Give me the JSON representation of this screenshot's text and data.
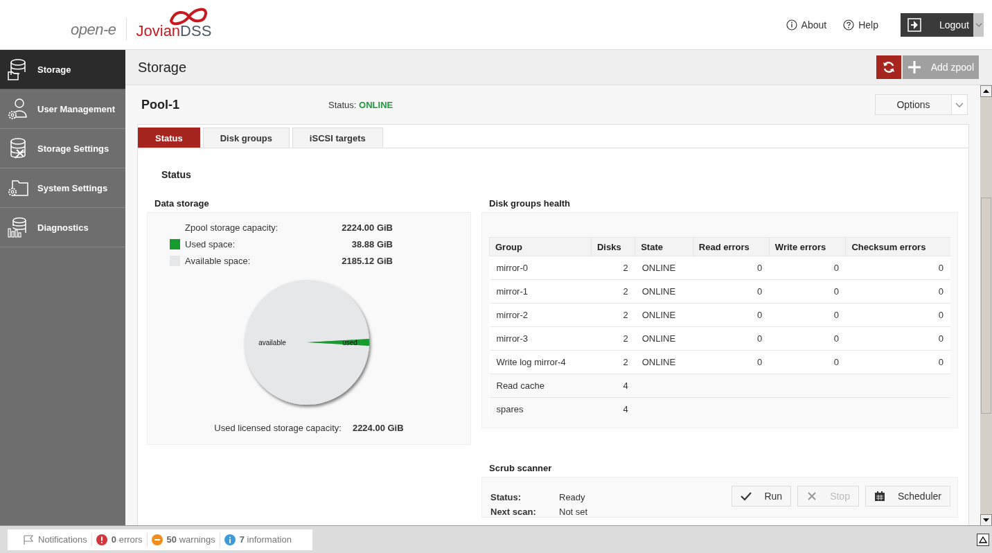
{
  "header": {
    "logo": {
      "brand": "open-e",
      "product_main": "Jovian",
      "product_suffix": "DSS"
    },
    "links": [
      {
        "label": "About",
        "kind": "info"
      },
      {
        "label": "Help",
        "kind": "help"
      }
    ],
    "logout": "Logout"
  },
  "sidebar": {
    "items": [
      {
        "label": "Storage",
        "kind": "storage",
        "selected": true
      },
      {
        "label": "User Management",
        "kind": "user",
        "selected": false
      },
      {
        "label": "Storage Settings",
        "kind": "storage-settings",
        "selected": false
      },
      {
        "label": "System Settings",
        "kind": "system",
        "selected": false
      },
      {
        "label": "Diagnostics",
        "kind": "diagnostics",
        "selected": false
      }
    ]
  },
  "page": {
    "title": "Storage",
    "add_button": "Add zpool"
  },
  "pool": {
    "name": "Pool-1",
    "status_label": "Status:",
    "status": "ONLINE",
    "options": "Options",
    "tabs": [
      {
        "label": "Status",
        "selected": true
      },
      {
        "label": "Disk groups",
        "selected": false
      },
      {
        "label": "iSCSI targets",
        "selected": false
      }
    ],
    "section_title": "Status",
    "data_storage": {
      "title": "Data storage",
      "rows": [
        {
          "label": "Zpool storage capacity:",
          "value": "2224.00 GiB"
        },
        {
          "label": "Used space:",
          "value": "38.88 GiB",
          "color": "#169b2f"
        },
        {
          "label": "Available space:",
          "value": "2185.12 GiB",
          "color": "#e6e7e9"
        }
      ],
      "chart_data": {
        "type": "pie",
        "categories": [
          "available",
          "used"
        ],
        "values": [
          98.25,
          1.75
        ],
        "colors": [
          "#e6e7e9",
          "#169b2f"
        ]
      },
      "licensed_label": "Used licensed storage capacity:",
      "licensed_value": "2224.00 GiB"
    },
    "disk_groups": {
      "title": "Disk groups health",
      "columns": [
        "Group",
        "Disks",
        "State",
        "Read errors",
        "Write errors",
        "Checksum errors"
      ],
      "rows": [
        {
          "group": "mirror-0",
          "disks": "2",
          "state": "ONLINE",
          "read": "0",
          "write": "0",
          "checksum": "0"
        },
        {
          "group": "mirror-1",
          "disks": "2",
          "state": "ONLINE",
          "read": "0",
          "write": "0",
          "checksum": "0"
        },
        {
          "group": "mirror-2",
          "disks": "2",
          "state": "ONLINE",
          "read": "0",
          "write": "0",
          "checksum": "0"
        },
        {
          "group": "mirror-3",
          "disks": "2",
          "state": "ONLINE",
          "read": "0",
          "write": "0",
          "checksum": "0"
        },
        {
          "group": "Write log mirror-4",
          "disks": "2",
          "state": "ONLINE",
          "read": "0",
          "write": "0",
          "checksum": "0"
        },
        {
          "group": "Read cache",
          "disks": "4"
        },
        {
          "group": "spares",
          "disks": "4"
        }
      ]
    },
    "scrub": {
      "title": "Scrub scanner",
      "fields": [
        {
          "label": "Status:",
          "value": "Ready"
        },
        {
          "label": "Next scan:",
          "value": "Not set"
        }
      ],
      "buttons": [
        {
          "label": "Run",
          "kind": "run",
          "disabled": false
        },
        {
          "label": "Stop",
          "kind": "stop",
          "disabled": true
        },
        {
          "label": "Scheduler",
          "kind": "scheduler",
          "disabled": false
        }
      ]
    }
  },
  "notifications": {
    "label": "Notifications",
    "items": [
      {
        "kind": "error",
        "count": "0",
        "label": "errors"
      },
      {
        "kind": "warning",
        "count": "50",
        "label": "warnings"
      },
      {
        "kind": "info",
        "count": "7",
        "label": "information"
      }
    ]
  }
}
